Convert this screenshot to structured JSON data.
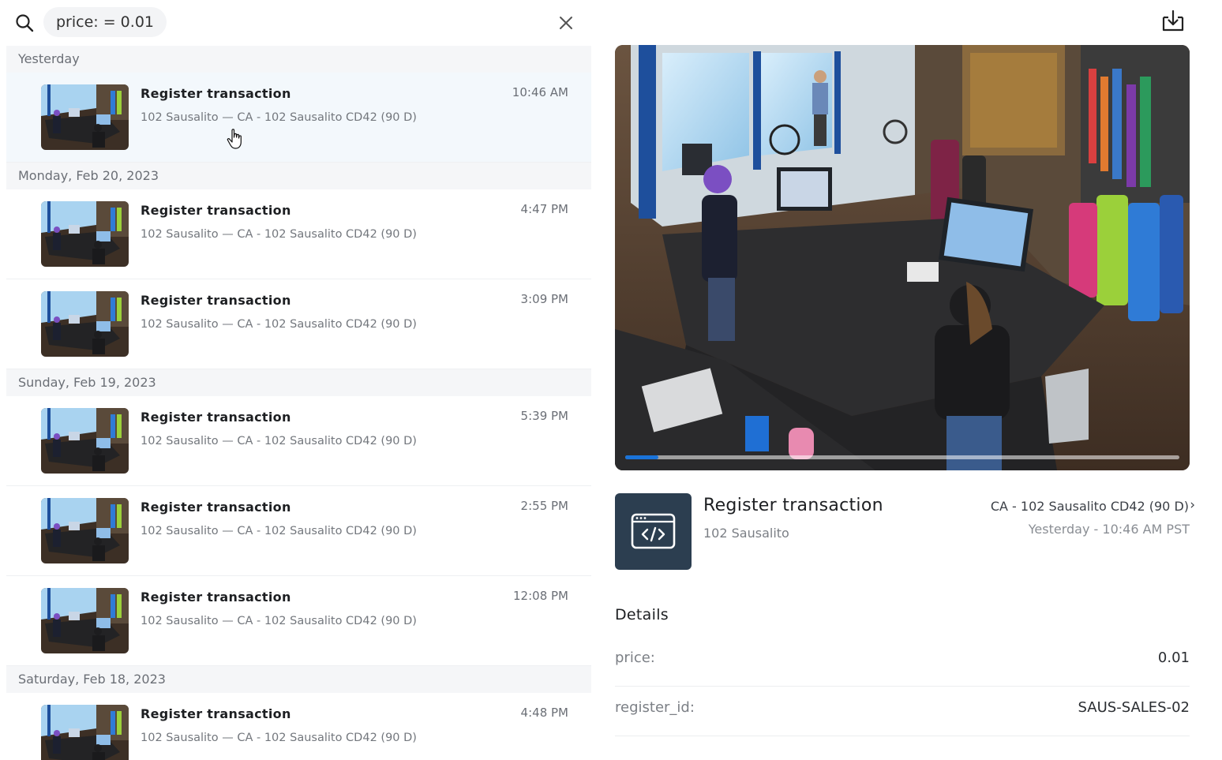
{
  "search": {
    "query": "price: = 0.01",
    "icon": "search-icon",
    "clear_icon": "close-icon"
  },
  "groups": [
    {
      "label": "Yesterday",
      "items": [
        {
          "title": "Register transaction",
          "subtitle": "102 Sausalito — CA - 102 Sausalito CD42 (90 D)",
          "time": "10:46 AM",
          "selected": true
        }
      ]
    },
    {
      "label": "Monday, Feb 20, 2023",
      "items": [
        {
          "title": "Register transaction",
          "subtitle": "102 Sausalito — CA - 102 Sausalito CD42 (90 D)",
          "time": "4:47 PM"
        },
        {
          "title": "Register transaction",
          "subtitle": "102 Sausalito — CA - 102 Sausalito CD42 (90 D)",
          "time": "3:09 PM"
        }
      ]
    },
    {
      "label": "Sunday, Feb 19, 2023",
      "items": [
        {
          "title": "Register transaction",
          "subtitle": "102 Sausalito — CA - 102 Sausalito CD42 (90 D)",
          "time": "5:39 PM"
        },
        {
          "title": "Register transaction",
          "subtitle": "102 Sausalito — CA - 102 Sausalito CD42 (90 D)",
          "time": "2:55 PM"
        },
        {
          "title": "Register transaction",
          "subtitle": "102 Sausalito — CA - 102 Sausalito CD42 (90 D)",
          "time": "12:08 PM"
        }
      ]
    },
    {
      "label": "Saturday, Feb 18, 2023",
      "items": [
        {
          "title": "Register transaction",
          "subtitle": "102 Sausalito — CA - 102 Sausalito CD42 (90 D)",
          "time": "4:48 PM"
        }
      ]
    }
  ],
  "player": {
    "download_icon": "download-icon",
    "progress": 0.06,
    "accent": "#1a73d9"
  },
  "event": {
    "icon": "code-window-icon",
    "title": "Register transaction",
    "site": "102 Sausalito",
    "camera": "CA - 102 Sausalito CD42 (90 D)",
    "camera_chevron": "›",
    "timestamp": "Yesterday - 10:46 AM PST"
  },
  "details": {
    "heading": "Details",
    "rows": [
      {
        "key": "price:",
        "value": "0.01"
      },
      {
        "key": "register_id:",
        "value": "SAUS-SALES-02"
      }
    ]
  },
  "colors": {
    "group_header_bg": "#f5f6f8",
    "selected_row_bg": "#f3f8fc",
    "event_icon_bg": "#2c3e50"
  }
}
